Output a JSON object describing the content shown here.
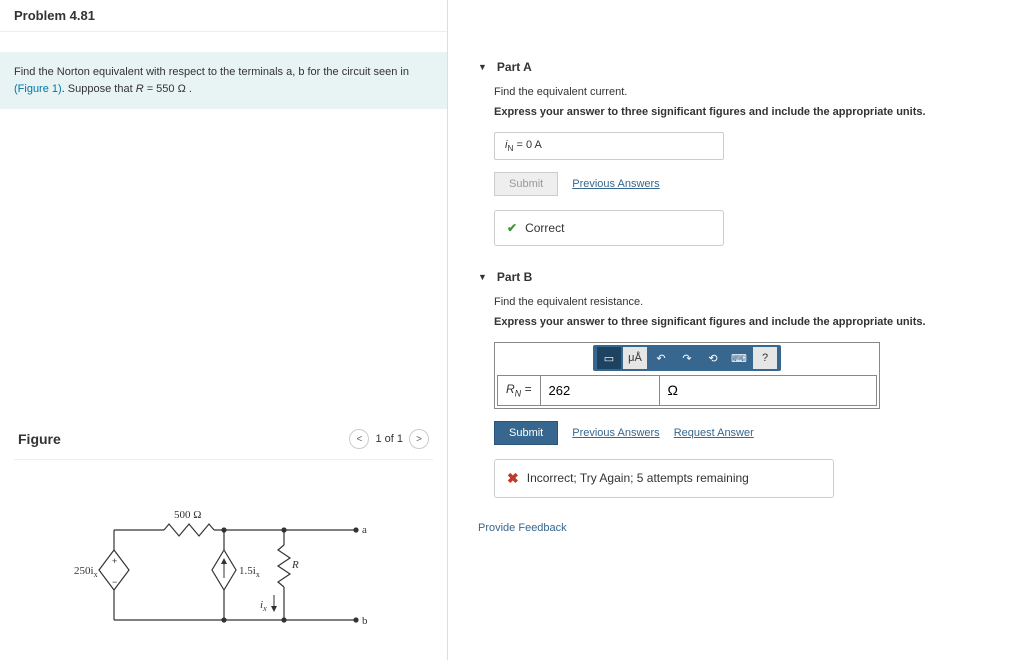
{
  "problem_title": "Problem 4.81",
  "prompt_text_1": "Find the Norton equivalent with respect to the terminals a, b for the circuit seen in ",
  "prompt_link": "(Figure 1)",
  "prompt_text_2": ". Suppose that ",
  "prompt_var": "R",
  "prompt_text_3": " = 550  Ω .",
  "figure": {
    "title": "Figure",
    "page_text": "1 of 1",
    "labels": {
      "r1": "500 Ω",
      "vs": "250i",
      "vs_sub": "x",
      "cs": "1.5i",
      "cs_sub": "x",
      "ix": "i",
      "ix_sub": "x",
      "r2": "R",
      "a": "a",
      "b": "b"
    }
  },
  "partA": {
    "title": "Part A",
    "instr": "Find the equivalent current.",
    "instr2": "Express your answer to three significant figures and include the appropriate units.",
    "answer_var": "i",
    "answer_sub": "N",
    "answer_eq": " =  0 A",
    "submit": "Submit",
    "prev": "Previous Answers",
    "feedback": "Correct"
  },
  "partB": {
    "title": "Part B",
    "instr": "Find the equivalent resistance.",
    "instr2": "Express your answer to three significant figures and include the appropriate units.",
    "toolbar": {
      "units": "μÅ",
      "help": "?"
    },
    "var": "R",
    "sub": "N",
    "eq": " = ",
    "value": "262",
    "unit": "Ω",
    "submit": "Submit",
    "prev": "Previous Answers",
    "req": "Request Answer",
    "feedback": "Incorrect; Try Again; 5 attempts remaining"
  },
  "provide_feedback": "Provide Feedback"
}
